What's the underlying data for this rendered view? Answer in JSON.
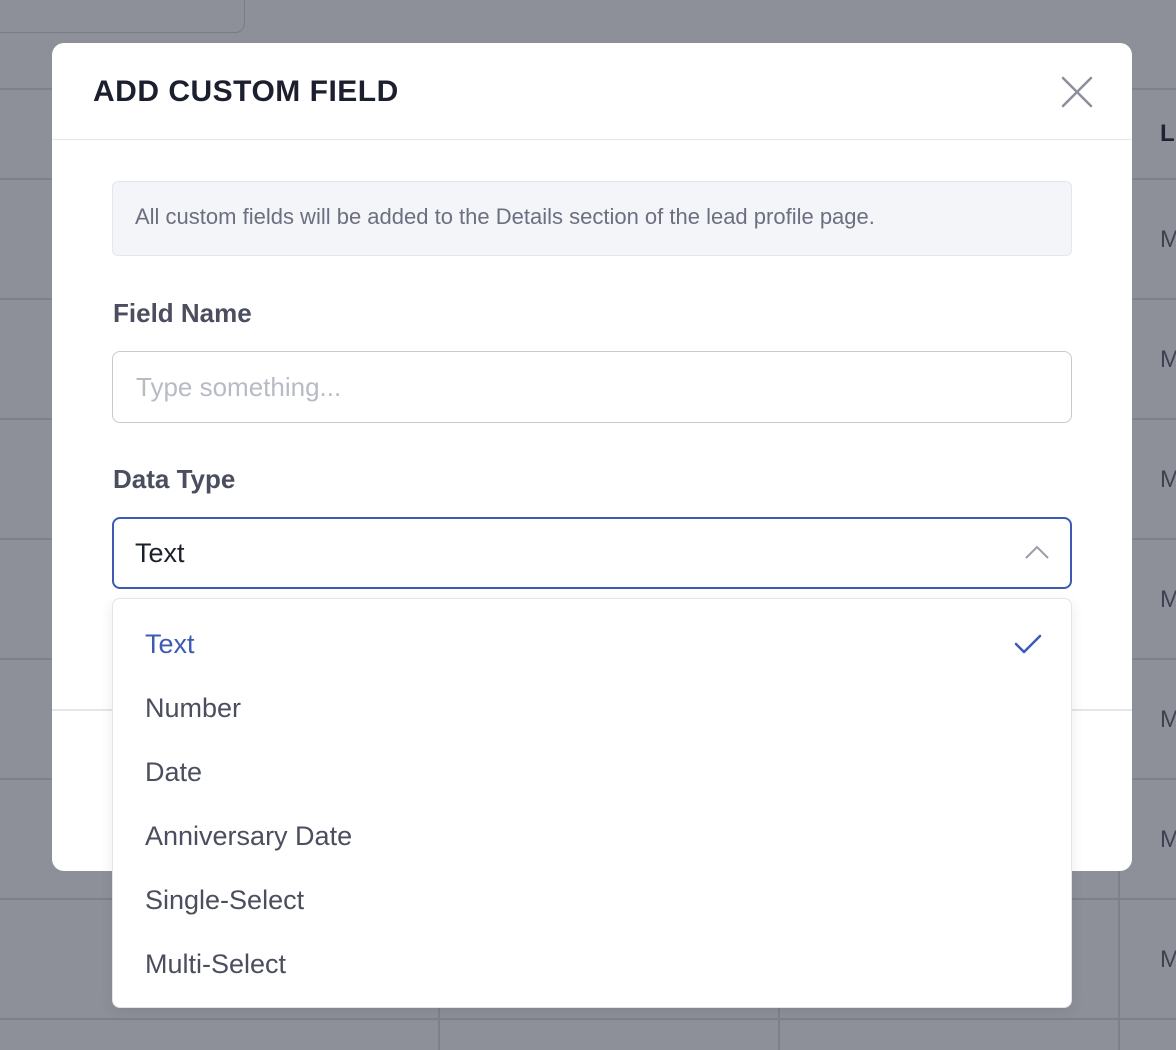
{
  "background": {
    "header_cell": "L",
    "row_cells": [
      "M",
      "M",
      "M",
      "M",
      "M",
      "M",
      "M"
    ]
  },
  "modal": {
    "title": "ADD CUSTOM FIELD",
    "close_icon": "close-icon",
    "info_text": "All custom fields will be added to the Details section of the lead profile page.",
    "field_name": {
      "label": "Field Name",
      "value": "",
      "placeholder": "Type something..."
    },
    "data_type": {
      "label": "Data Type",
      "selected": "Text",
      "expanded": true,
      "options": [
        {
          "label": "Text",
          "selected": true
        },
        {
          "label": "Number",
          "selected": false
        },
        {
          "label": "Date",
          "selected": false
        },
        {
          "label": "Anniversary Date",
          "selected": false
        },
        {
          "label": "Single-Select",
          "selected": false
        },
        {
          "label": "Multi-Select",
          "selected": false
        }
      ]
    }
  },
  "colors": {
    "accent": "#3d5bb5",
    "overlay": "#8e9099",
    "title": "#1c1f2e"
  }
}
